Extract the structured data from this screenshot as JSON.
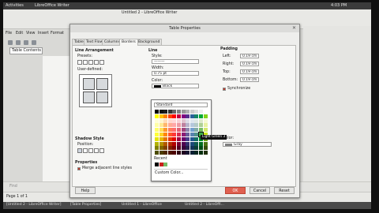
{
  "topbar": {
    "activities": "Activities",
    "app": "LibreOffice Writer",
    "time": "4:03 PM"
  },
  "window": {
    "title": "Untitled 2 - LibreOffice Writer"
  },
  "menu": [
    "File",
    "Edit",
    "View",
    "Insert",
    "Format"
  ],
  "style_box": "Table Contents",
  "dialog": {
    "title": "Table Properties",
    "tabs": [
      "Table",
      "Text Flow",
      "Columns",
      "Borders",
      "Background"
    ],
    "active_tab": 3,
    "line_arrangement": {
      "heading": "Line Arrangement",
      "presets_label": "Presets:",
      "user_defined_label": "User-defined:"
    },
    "line": {
      "heading": "Line",
      "style_label": "Style:",
      "style_value": "———",
      "width_label": "Width:",
      "width_value": "0.75 pt",
      "color_label": "Color:",
      "color_value": "Black"
    },
    "padding": {
      "heading": "Padding",
      "left_label": "Left:",
      "left_value": "0.19 cm",
      "right_label": "Right:",
      "right_value": "0.19 cm",
      "top_label": "Top:",
      "top_value": "0.19 cm",
      "bottom_label": "Bottom:",
      "bottom_value": "0.19 cm",
      "synchronize_label": "Synchronize"
    },
    "shadow": {
      "heading": "Shadow Style",
      "position_label": "Position:",
      "color_label": "Color:",
      "color_value": "Gray"
    },
    "properties": {
      "heading": "Properties",
      "merge_label": "Merge adjacent line styles"
    },
    "buttons": {
      "help": "Help",
      "ok": "OK",
      "cancel": "Cancel",
      "reset": "Reset"
    }
  },
  "palette": {
    "selector": "Standard",
    "recent_label": "Recent",
    "custom_label": "Custom Color...",
    "tooltip": "Light Green 3",
    "colors": [
      [
        "#000000",
        "#111111",
        "#1c1c1c",
        "#333333",
        "#666666",
        "#808080",
        "#999999",
        "#b2b2b2",
        "#cccccc",
        "#dddddd",
        "#eeeeee",
        "#ffffff"
      ],
      [
        "#ffff00",
        "#ffbf00",
        "#ff8000",
        "#ff4000",
        "#ff0000",
        "#bf0041",
        "#800080",
        "#55308d",
        "#2a6099",
        "#158466",
        "#00a933",
        "#81d41a"
      ],
      [
        "#ffffd7",
        "#fff5ce",
        "#ffdbb6",
        "#ffd8ce",
        "#ffd7d7",
        "#f7d1d5",
        "#e0c2cd",
        "#dedce6",
        "#dee6ef",
        "#dee7e5",
        "#dde8cb",
        "#f6f9d4"
      ],
      [
        "#ffffa6",
        "#ffe994",
        "#ffb66c",
        "#ffaa95",
        "#ffa6a6",
        "#ec9ba4",
        "#bf819e",
        "#b7b3ca",
        "#b4c7dc",
        "#b3cac7",
        "#afd095",
        "#e8f2a1"
      ],
      [
        "#ffff6d",
        "#ffde59",
        "#ff972f",
        "#ff7b59",
        "#ff6d6d",
        "#e16173",
        "#a1467e",
        "#8e86ae",
        "#729fcf",
        "#81aca6",
        "#77bc65",
        "#d4ea6b"
      ],
      [
        "#ffff38",
        "#ffd428",
        "#ff860d",
        "#ff5429",
        "#ff3838",
        "#d62e4e",
        "#8d1d75",
        "#6b5e9b",
        "#5983b0",
        "#50938a",
        "#3faf46",
        "#c9e711"
      ],
      [
        "#e6e600",
        "#e6b800",
        "#e67300",
        "#e63600",
        "#e60000",
        "#a3003f",
        "#6b006b",
        "#483d8b",
        "#21578f",
        "#127061",
        "#008f29",
        "#6ea31a"
      ],
      [
        "#b2b200",
        "#b28f00",
        "#b25900",
        "#b22a00",
        "#b20000",
        "#7a002f",
        "#500050",
        "#35306d",
        "#1b4a7a",
        "#0e5a4e",
        "#006e20",
        "#4d7414"
      ],
      [
        "#808000",
        "#806600",
        "#804000",
        "#801f00",
        "#800000",
        "#520020",
        "#3a003a",
        "#241f4b",
        "#123559",
        "#0a3f37",
        "#004d15",
        "#35500d"
      ],
      [
        "#4d4d00",
        "#4d3d00",
        "#4d2600",
        "#4d1300",
        "#4d0000",
        "#2f0012",
        "#200020",
        "#161430",
        "#0a1f33",
        "#062621",
        "#002e0c",
        "#1f2e08"
      ]
    ],
    "recent": [
      "#000000",
      "#c9211e",
      "#77bc65"
    ]
  },
  "statusbar": {
    "find_placeholder": "Find",
    "page": "Page 1 of 1"
  },
  "taskbar": [
    "[Untitled 2 - LibreOffice Writer]",
    "[Table Properties]",
    "Untitled 1 - LibreOffice",
    "Untitled 2 - LibreOffi..."
  ]
}
